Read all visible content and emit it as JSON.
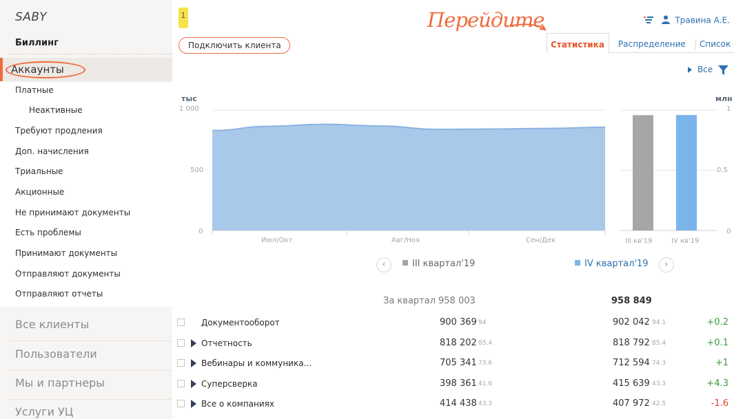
{
  "sidebar": {
    "logo": "SABY",
    "section_title": "Биллинг",
    "active_item": "Аккаунты",
    "items": [
      {
        "label": "Платные"
      },
      {
        "label": "Неактивные"
      },
      {
        "label": "Требуют продления"
      },
      {
        "label": "Доп. начисления"
      },
      {
        "label": "Триальные"
      },
      {
        "label": "Акционные"
      },
      {
        "label": "Не принимают документы"
      },
      {
        "label": "Есть проблемы"
      },
      {
        "label": "Принимают документы"
      },
      {
        "label": "Отправляют документы"
      },
      {
        "label": "Отправляют отчеты"
      }
    ],
    "sections": [
      "Все клиенты",
      "Пользователи",
      "Мы и партнеры",
      "Услуги УЦ"
    ]
  },
  "header": {
    "badge": "1",
    "connect_button": "Подключить клиента",
    "annotation": "Перейдите",
    "user_name": "Травина А.Е.",
    "filter_icon": "filter-lines-icon",
    "user_icon": "user-icon"
  },
  "tabs": [
    "Статистика",
    "Распределение",
    "Список"
  ],
  "filter": {
    "label": "Все"
  },
  "colors": {
    "accent": "#f06a3d",
    "area_fill": "#a9c9ea",
    "area_line": "#8ab4e0",
    "bar_q3": "#a6a6a6",
    "bar_q4": "#7ab4ea",
    "link": "#2d6fb0",
    "positive": "#3a9a3a",
    "negative": "#e0402a"
  },
  "chart_data": [
    {
      "type": "area",
      "ylabel": "тыс",
      "ylim": [
        0,
        1000
      ],
      "yticks": [
        "1 000",
        "500",
        "0"
      ],
      "x": [
        "Июл/Окт",
        "Авг/Ноя",
        "Сен/Дек"
      ],
      "series": [
        {
          "values": [
            830,
            865,
            882,
            868,
            840,
            843,
            848,
            858
          ]
        }
      ]
    },
    {
      "type": "bar",
      "ylabel": "млн",
      "ylim": [
        0,
        1
      ],
      "yticks": [
        "1",
        "0.5",
        "0"
      ],
      "categories": [
        "III кв'19",
        "IV кв'19"
      ],
      "values": [
        0.958003,
        0.958849
      ]
    }
  ],
  "legend": {
    "prev_icon": "chevron-left-icon",
    "next_icon": "chevron-right-icon",
    "q3": "III квартал'19",
    "q4": "IV квартал'19"
  },
  "table": {
    "total_label": "За квартал",
    "total_q3": "958 003",
    "total_q4": "958 849",
    "rows": [
      {
        "name": "Документооборот",
        "expandable": false,
        "q3": "900 369",
        "q3_pct": "94",
        "q4": "902 042",
        "q4_pct": "94.1",
        "diff": "+0.2"
      },
      {
        "name": "Отчетность",
        "expandable": true,
        "q3": "818 202",
        "q3_pct": "85.4",
        "q4": "818 792",
        "q4_pct": "85.4",
        "diff": "+0.1"
      },
      {
        "name": "Вебинары и коммуника...",
        "expandable": true,
        "q3": "705 341",
        "q3_pct": "73.6",
        "q4": "712 594",
        "q4_pct": "74.3",
        "diff": "+1"
      },
      {
        "name": "Суперсверка",
        "expandable": true,
        "q3": "398 361",
        "q3_pct": "41.6",
        "q4": "415 639",
        "q4_pct": "43.3",
        "diff": "+4.3"
      },
      {
        "name": "Все о компаниях",
        "expandable": true,
        "q3": "414 438",
        "q3_pct": "43.3",
        "q4": "407 972",
        "q4_pct": "42.5",
        "diff": "-1.6"
      }
    ]
  }
}
